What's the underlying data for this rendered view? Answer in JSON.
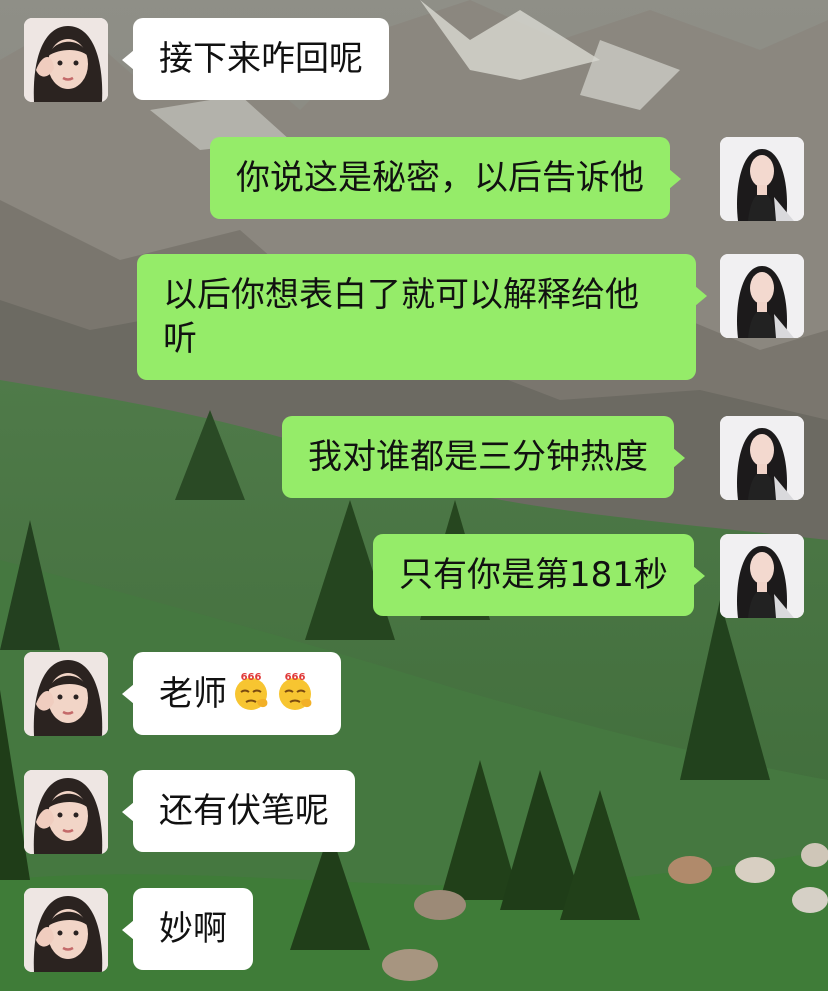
{
  "messages": [
    {
      "side": "left",
      "avatar": "friend-avatar",
      "text": "接下来咋回呢"
    },
    {
      "side": "right",
      "avatar": "user-avatar",
      "text": "你说这是秘密，以后告诉他"
    },
    {
      "side": "right",
      "avatar": "user-avatar",
      "text": "以后你想表白了就可以解释给他听"
    },
    {
      "side": "right",
      "avatar": "user-avatar",
      "text": "我对谁都是三分钟热度"
    },
    {
      "side": "right",
      "avatar": "user-avatar",
      "text": "只有你是第181秒"
    },
    {
      "side": "left",
      "avatar": "friend-avatar",
      "text": "老师",
      "emojis": [
        "666-emoji",
        "666-emoji"
      ],
      "emoji_badge": "666"
    },
    {
      "side": "left",
      "avatar": "friend-avatar",
      "text": "还有伏笔呢"
    },
    {
      "side": "left",
      "avatar": "friend-avatar",
      "text": "妙啊"
    }
  ],
  "colors": {
    "outgoing_bubble": "#95ec69",
    "incoming_bubble": "#ffffff",
    "text": "#111111"
  }
}
